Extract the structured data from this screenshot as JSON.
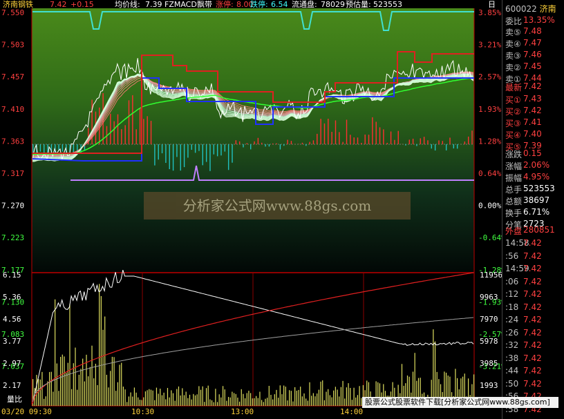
{
  "header": {
    "stock_name": "济南钢铁",
    "price": "7.42",
    "change": "+0.15",
    "avg_label": "均价线:",
    "avg_value": "7.39",
    "indicator": "FZMACD飘带",
    "limit_up_label": "涨停:",
    "limit_up_value": "8.00",
    "limit_down_label": "跌停:",
    "limit_down_value": "6.54",
    "float_label": "流通盘:",
    "float_value": "78029",
    "est_label": "预估量:",
    "est_value": "523553",
    "tab_label": "日"
  },
  "price_axis": {
    "left": [
      "7.550",
      "7.503",
      "7.457",
      "7.410",
      "7.363",
      "7.317",
      "7.270",
      "7.223",
      "7.177",
      "7.130",
      "7.083",
      "7.037"
    ],
    "right": [
      "3.85%",
      "3.21%",
      "2.57%",
      "1.93%",
      "1.28%",
      "0.64%",
      "0.00%",
      "-0.64%",
      "-1.28%",
      "-1.93%",
      "-2.57%",
      "-3.21%"
    ]
  },
  "volume_axis": {
    "left": [
      "6.15",
      "5.36",
      "4.56",
      "3.77",
      "2.97",
      "2.17"
    ],
    "right": [
      "11956",
      "9963",
      "7970",
      "5978",
      "3985",
      "1993"
    ],
    "caption": "量比"
  },
  "time_axis": [
    "03/20 09:30",
    "10:30",
    "13:00",
    "14:00"
  ],
  "side_panel": {
    "code": "600022",
    "name_short": "济南",
    "weibi_label": "委比",
    "weibi_value": "13.35%",
    "asks": [
      {
        "label": "卖⑤",
        "price": "7.48"
      },
      {
        "label": "卖④",
        "price": "7.47"
      },
      {
        "label": "卖③",
        "price": "7.46"
      },
      {
        "label": "卖②",
        "price": "7.45"
      },
      {
        "label": "卖①",
        "price": "7.44"
      }
    ],
    "latest_label": "最新",
    "latest_value": "7.42",
    "bids": [
      {
        "label": "买①",
        "price": "7.43"
      },
      {
        "label": "买②",
        "price": "7.42"
      },
      {
        "label": "买③",
        "price": "7.41"
      },
      {
        "label": "买④",
        "price": "7.40"
      },
      {
        "label": "买⑤",
        "price": "7.39"
      }
    ],
    "stats": [
      {
        "label": "涨跌",
        "value": "0.15"
      },
      {
        "label": "涨幅",
        "value": "2.06%"
      },
      {
        "label": "振幅",
        "value": "4.95%"
      },
      {
        "label": "总手",
        "value": "523553"
      },
      {
        "label": "总额",
        "value": "38697"
      },
      {
        "label": "换手",
        "value": "6.71%"
      },
      {
        "label": "分笔",
        "value": "2723"
      }
    ],
    "outer_label": "外盘",
    "outer_value": "280851",
    "ticks": [
      {
        "time": "14:58",
        "price": "7.42"
      },
      {
        "time": ":56",
        "price": "7.42"
      },
      {
        "time": "14:59",
        "price": "7.42"
      },
      {
        "time": ":06",
        "price": "7.42"
      },
      {
        "time": ":12",
        "price": "7.42"
      },
      {
        "time": ":18",
        "price": "7.42"
      },
      {
        "time": ":24",
        "price": "7.42"
      },
      {
        "time": ":26",
        "price": "7.42"
      },
      {
        "time": ":32",
        "price": "7.42"
      },
      {
        "time": ":38",
        "price": "7.42"
      },
      {
        "time": ":44",
        "price": "7.42"
      },
      {
        "time": ":50",
        "price": "7.42"
      },
      {
        "time": ":56",
        "price": "7.42"
      },
      {
        "time": ":58",
        "price": "7.42"
      }
    ]
  },
  "watermark": "分析家公式网www.88gs.com",
  "bottom_watermark": "股票公式股票软件下载[分析家公式网www.88gs.com]",
  "colors": {
    "up": "#ff3030",
    "down": "#00d0d0",
    "grid": "#8b0000",
    "white": "#ffffff",
    "blue": "#2040ff",
    "green": "#30ff30",
    "purple": "#c080ff",
    "yellow": "#ffff60"
  }
}
